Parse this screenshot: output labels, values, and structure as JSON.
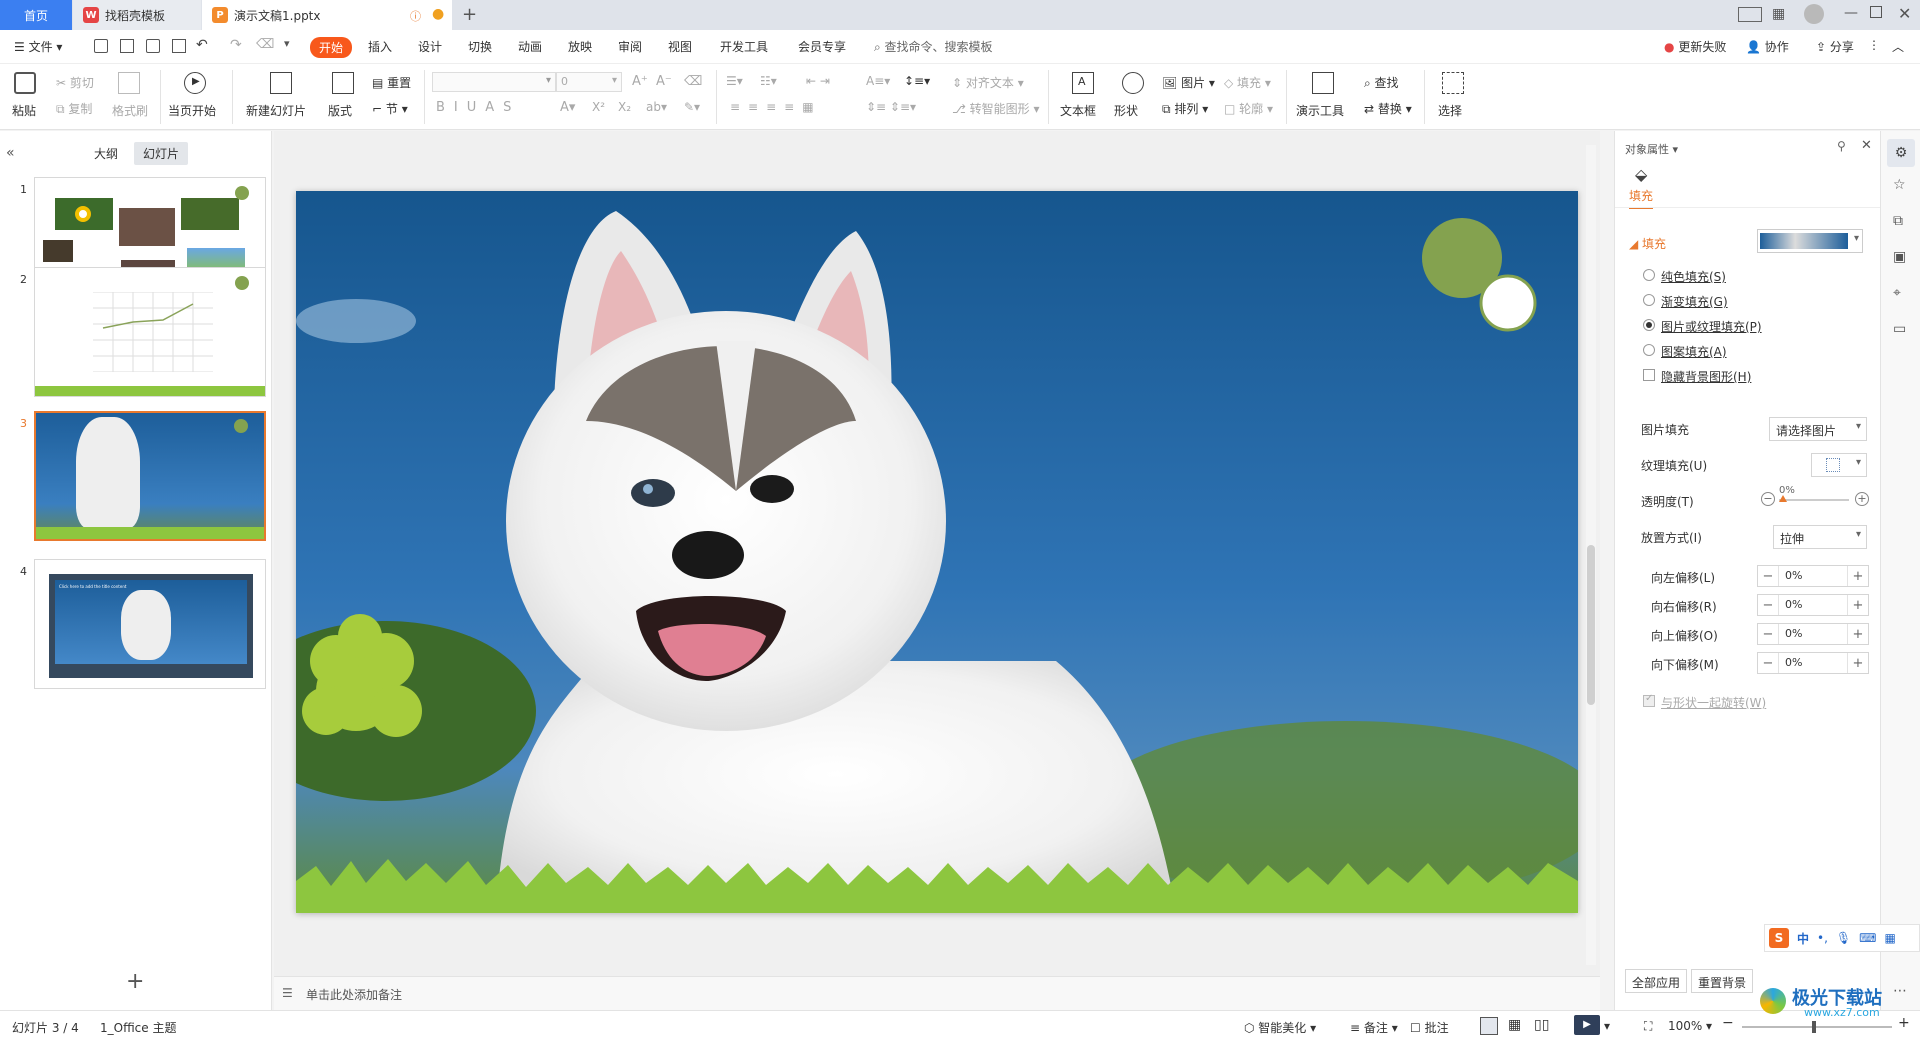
{
  "tabs": {
    "home": "首页",
    "templates": "找稻壳模板",
    "document": "演示文稿1.pptx"
  },
  "menu": {
    "file": "文件",
    "items": [
      "开始",
      "插入",
      "设计",
      "切换",
      "动画",
      "放映",
      "审阅",
      "视图",
      "开发工具",
      "会员专享"
    ],
    "search_placeholder": "查找命令、搜索模板",
    "update_failed": "更新失败",
    "collaborate": "协作",
    "share": "分享"
  },
  "ribbon": {
    "paste": "粘贴",
    "cut": "剪切",
    "copy": "复制",
    "format_painter": "格式刷",
    "from_current": "当页开始",
    "new_slide": "新建幻灯片",
    "layout": "版式",
    "section": "节",
    "reset": "重置",
    "font_size": "0",
    "align_text": "对齐文本",
    "smart_art": "转智能图形",
    "text_box": "文本框",
    "shape": "形状",
    "picture": "图片",
    "arrange": "排列",
    "fill": "填充",
    "outline": "轮廓",
    "present_tools": "演示工具",
    "find": "查找",
    "replace": "替换",
    "select": "选择"
  },
  "left_panel": {
    "tab_outline": "大纲",
    "tab_slides": "幻灯片",
    "slide_numbers": [
      "1",
      "2",
      "3",
      "4"
    ],
    "slide4_title": "Click here to add the title content"
  },
  "notes_placeholder": "单击此处添加备注",
  "right_panel": {
    "title": "对象属性",
    "fill_tab": "填充",
    "fill_section": "填充",
    "options": [
      "纯色填充(S)",
      "渐变填充(G)",
      "图片或纹理填充(P)",
      "图案填充(A)"
    ],
    "selected_option": "图片或纹理填充(P)",
    "hide_bg_shapes": "隐藏背景图形(H)",
    "picture_fill_label": "图片填充",
    "picture_fill_value": "请选择图片",
    "texture_fill_label": "纹理填充(U)",
    "transparency_label": "透明度(T)",
    "transparency_value": "0%",
    "placement_label": "放置方式(I)",
    "placement_value": "拉伸",
    "offsets": [
      {
        "label": "向左偏移(L)",
        "value": "0%"
      },
      {
        "label": "向右偏移(R)",
        "value": "0%"
      },
      {
        "label": "向上偏移(O)",
        "value": "0%"
      },
      {
        "label": "向下偏移(M)",
        "value": "0%"
      }
    ],
    "rotate_with_shape": "与形状一起旋转(W)",
    "apply_all": "全部应用",
    "reset_bg": "重置背景"
  },
  "status": {
    "slide_pos": "幻灯片 3 / 4",
    "theme": "1_Office 主题",
    "beautify": "智能美化",
    "notes": "备注",
    "comments": "批注",
    "zoom": "100%"
  },
  "ime": {
    "lang": "中"
  },
  "watermark": {
    "site_cn": "极光下载站",
    "site_url": "www.xz7.com"
  },
  "colors": {
    "accent_orange": "#f8581b",
    "tab_blue": "#3b7ff1",
    "sky_top": "#1d5e9a",
    "grass": "#8dc63f",
    "green_circle": "#84a24f"
  }
}
